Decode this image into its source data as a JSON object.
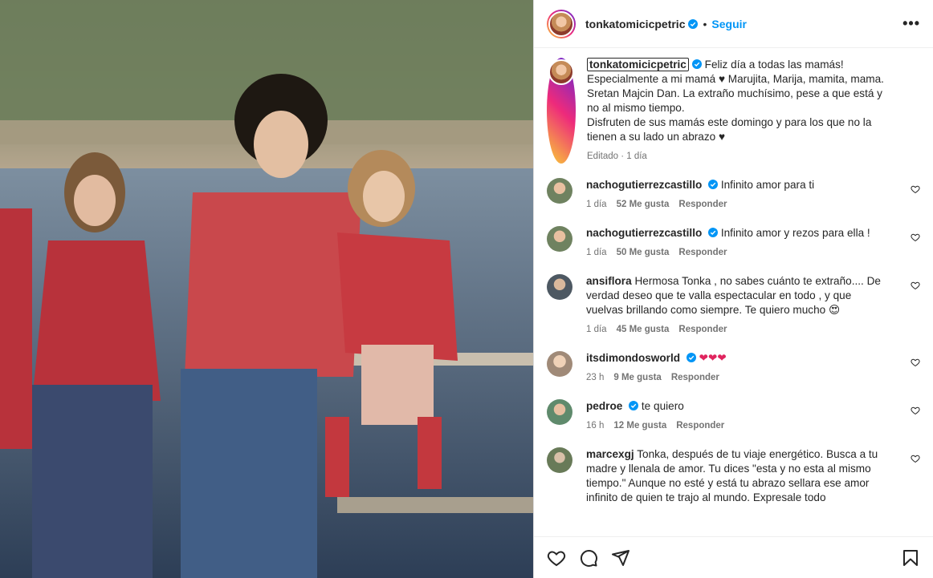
{
  "post": {
    "username": "tonkatomicicpetric",
    "follow_label": "Seguir",
    "separator": "•",
    "more_label": "•••"
  },
  "caption": {
    "username": "tonkatomicicpetric",
    "text": " Feliz día a todas las mamás! Especialmente a mi mamá ♥ Marujita, Marija, mamita, mama. Sretan Majcin Dan. La extraño muchísimo, pese a que está y no al mismo tiempo.",
    "text2": "Disfruten de sus mamás este domingo y para los que no la tienen a su lado un abrazo ♥",
    "edited": "Editado",
    "time": "1 día"
  },
  "comments": [
    {
      "user": "nachogutierrezcastillo",
      "verified": true,
      "text": "Infinito amor para ti",
      "time": "1 día",
      "likes": "52 Me gusta",
      "reply": "Responder",
      "avatar_color": "#7a8d6b"
    },
    {
      "user": "nachogutierrezcastillo",
      "verified": true,
      "text": "Infinito amor y rezos para ella !",
      "time": "1 día",
      "likes": "50 Me gusta",
      "reply": "Responder",
      "avatar_color": "#7a8d6b"
    },
    {
      "user": "ansiflora",
      "verified": false,
      "text": "Hermosa Tonka , no sabes cuánto te extraño.... De verdad deseo que te valla espectacular en todo , y que vuelvas brillando como siempre. Te quiero mucho 😍",
      "time": "1 día",
      "likes": "45 Me gusta",
      "reply": "Responder",
      "avatar_color": "#5b6670"
    },
    {
      "user": "itsdimondosworld",
      "verified": true,
      "text": "❤❤❤",
      "time": "23 h",
      "likes": "9 Me gusta",
      "reply": "Responder",
      "avatar_color": "#b49a86"
    },
    {
      "user": "pedroe",
      "verified": true,
      "text": "te quiero",
      "time": "16 h",
      "likes": "12 Me gusta",
      "reply": "Responder",
      "avatar_color": "#6b8f78"
    },
    {
      "user": "marcexgj",
      "verified": false,
      "text": "Tonka, después de tu viaje energético. Busca a tu madre y llenala de amor. Tu dices \"esta y no esta al mismo tiempo.\" Aunque no esté y está tu abrazo sellara ese amor infinito de quien te trajo al mundo. Expresale todo",
      "time": "",
      "likes": "",
      "reply": "",
      "avatar_color": "#6e7d5f"
    }
  ],
  "colors": {
    "accent": "#0095f6",
    "verified": "#0095f6",
    "heart": "#e0245e"
  },
  "icons": [
    "heart-icon",
    "comment-icon",
    "share-icon",
    "bookmark-icon",
    "verified-icon",
    "more-icon"
  ]
}
